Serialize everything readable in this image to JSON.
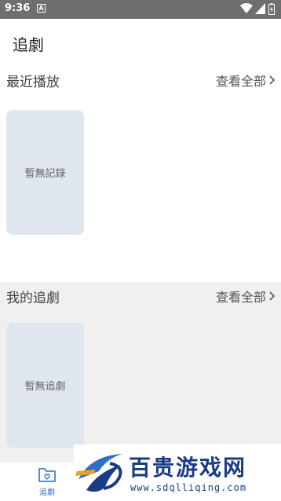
{
  "status": {
    "time": "9:36",
    "a_glyph": "A"
  },
  "header": {
    "title": "追劇"
  },
  "recent": {
    "title": "最近播放",
    "view_all": "查看全部",
    "empty_text": "暫無記錄"
  },
  "favorites": {
    "title": "我的追劇",
    "view_all": "查看全部",
    "empty_text": "暫無追劇"
  },
  "nav": {
    "items": [
      {
        "label": "追劇",
        "icon": "folder-heart-icon",
        "active": true
      }
    ]
  },
  "watermark": {
    "title": "百贵游戏网",
    "url": "www.sdqlliqing.com"
  },
  "colors": {
    "statusbar": "#6f6f6f",
    "card": "#dfe6ee",
    "section_alt_bg": "#f0f0f0",
    "nav_active": "#2f6fc9",
    "watermark": "#1a3c87"
  }
}
